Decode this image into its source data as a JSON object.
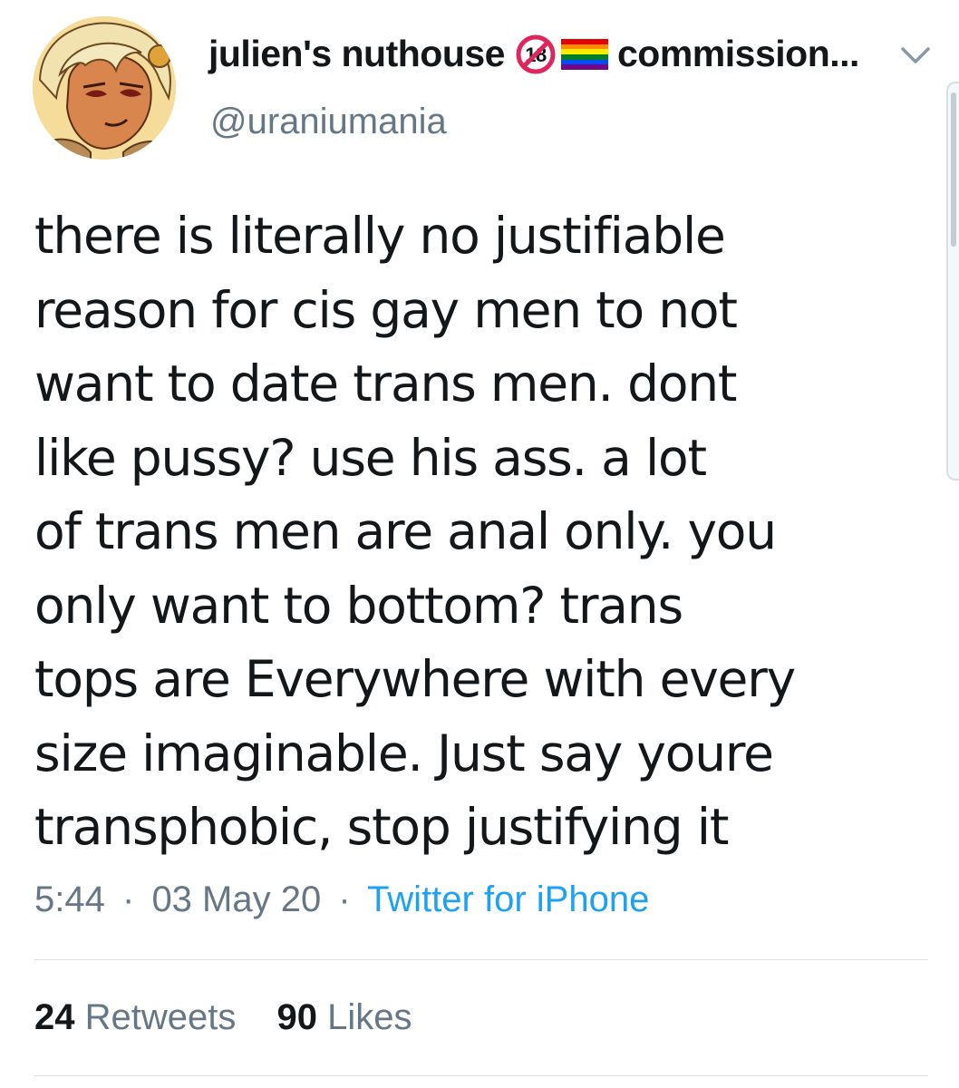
{
  "author": {
    "display_name": "julien's nuthouse",
    "name_suffix": "commission...",
    "handle": "@uraniumania",
    "avatar_icon": "anime-character-avatar-icon",
    "badge_icon": "no-under-18-icon",
    "badge_text": "18",
    "flag_icon": "rainbow-flag-icon"
  },
  "tweet": {
    "lines": [
      "there is literally no justifiable",
      "reason for cis gay men to not",
      "want to date trans men. dont",
      "like pussy? use his ass. a lot",
      "of trans men are anal only. you",
      "only want to bottom? trans",
      "tops are Everywhere with every",
      "size imaginable. Just say youre",
      "transphobic, stop justifying it"
    ]
  },
  "meta": {
    "time": "5:44",
    "separator": "·",
    "date": "03 May 20",
    "source": "Twitter for iPhone"
  },
  "stats": {
    "retweets_count": "24",
    "retweets_label": "Retweets",
    "likes_count": "90",
    "likes_label": "Likes"
  },
  "colors": {
    "text": "#14171a",
    "secondary": "#657786",
    "link": "#1da1f2",
    "divider": "#d8dee3"
  }
}
